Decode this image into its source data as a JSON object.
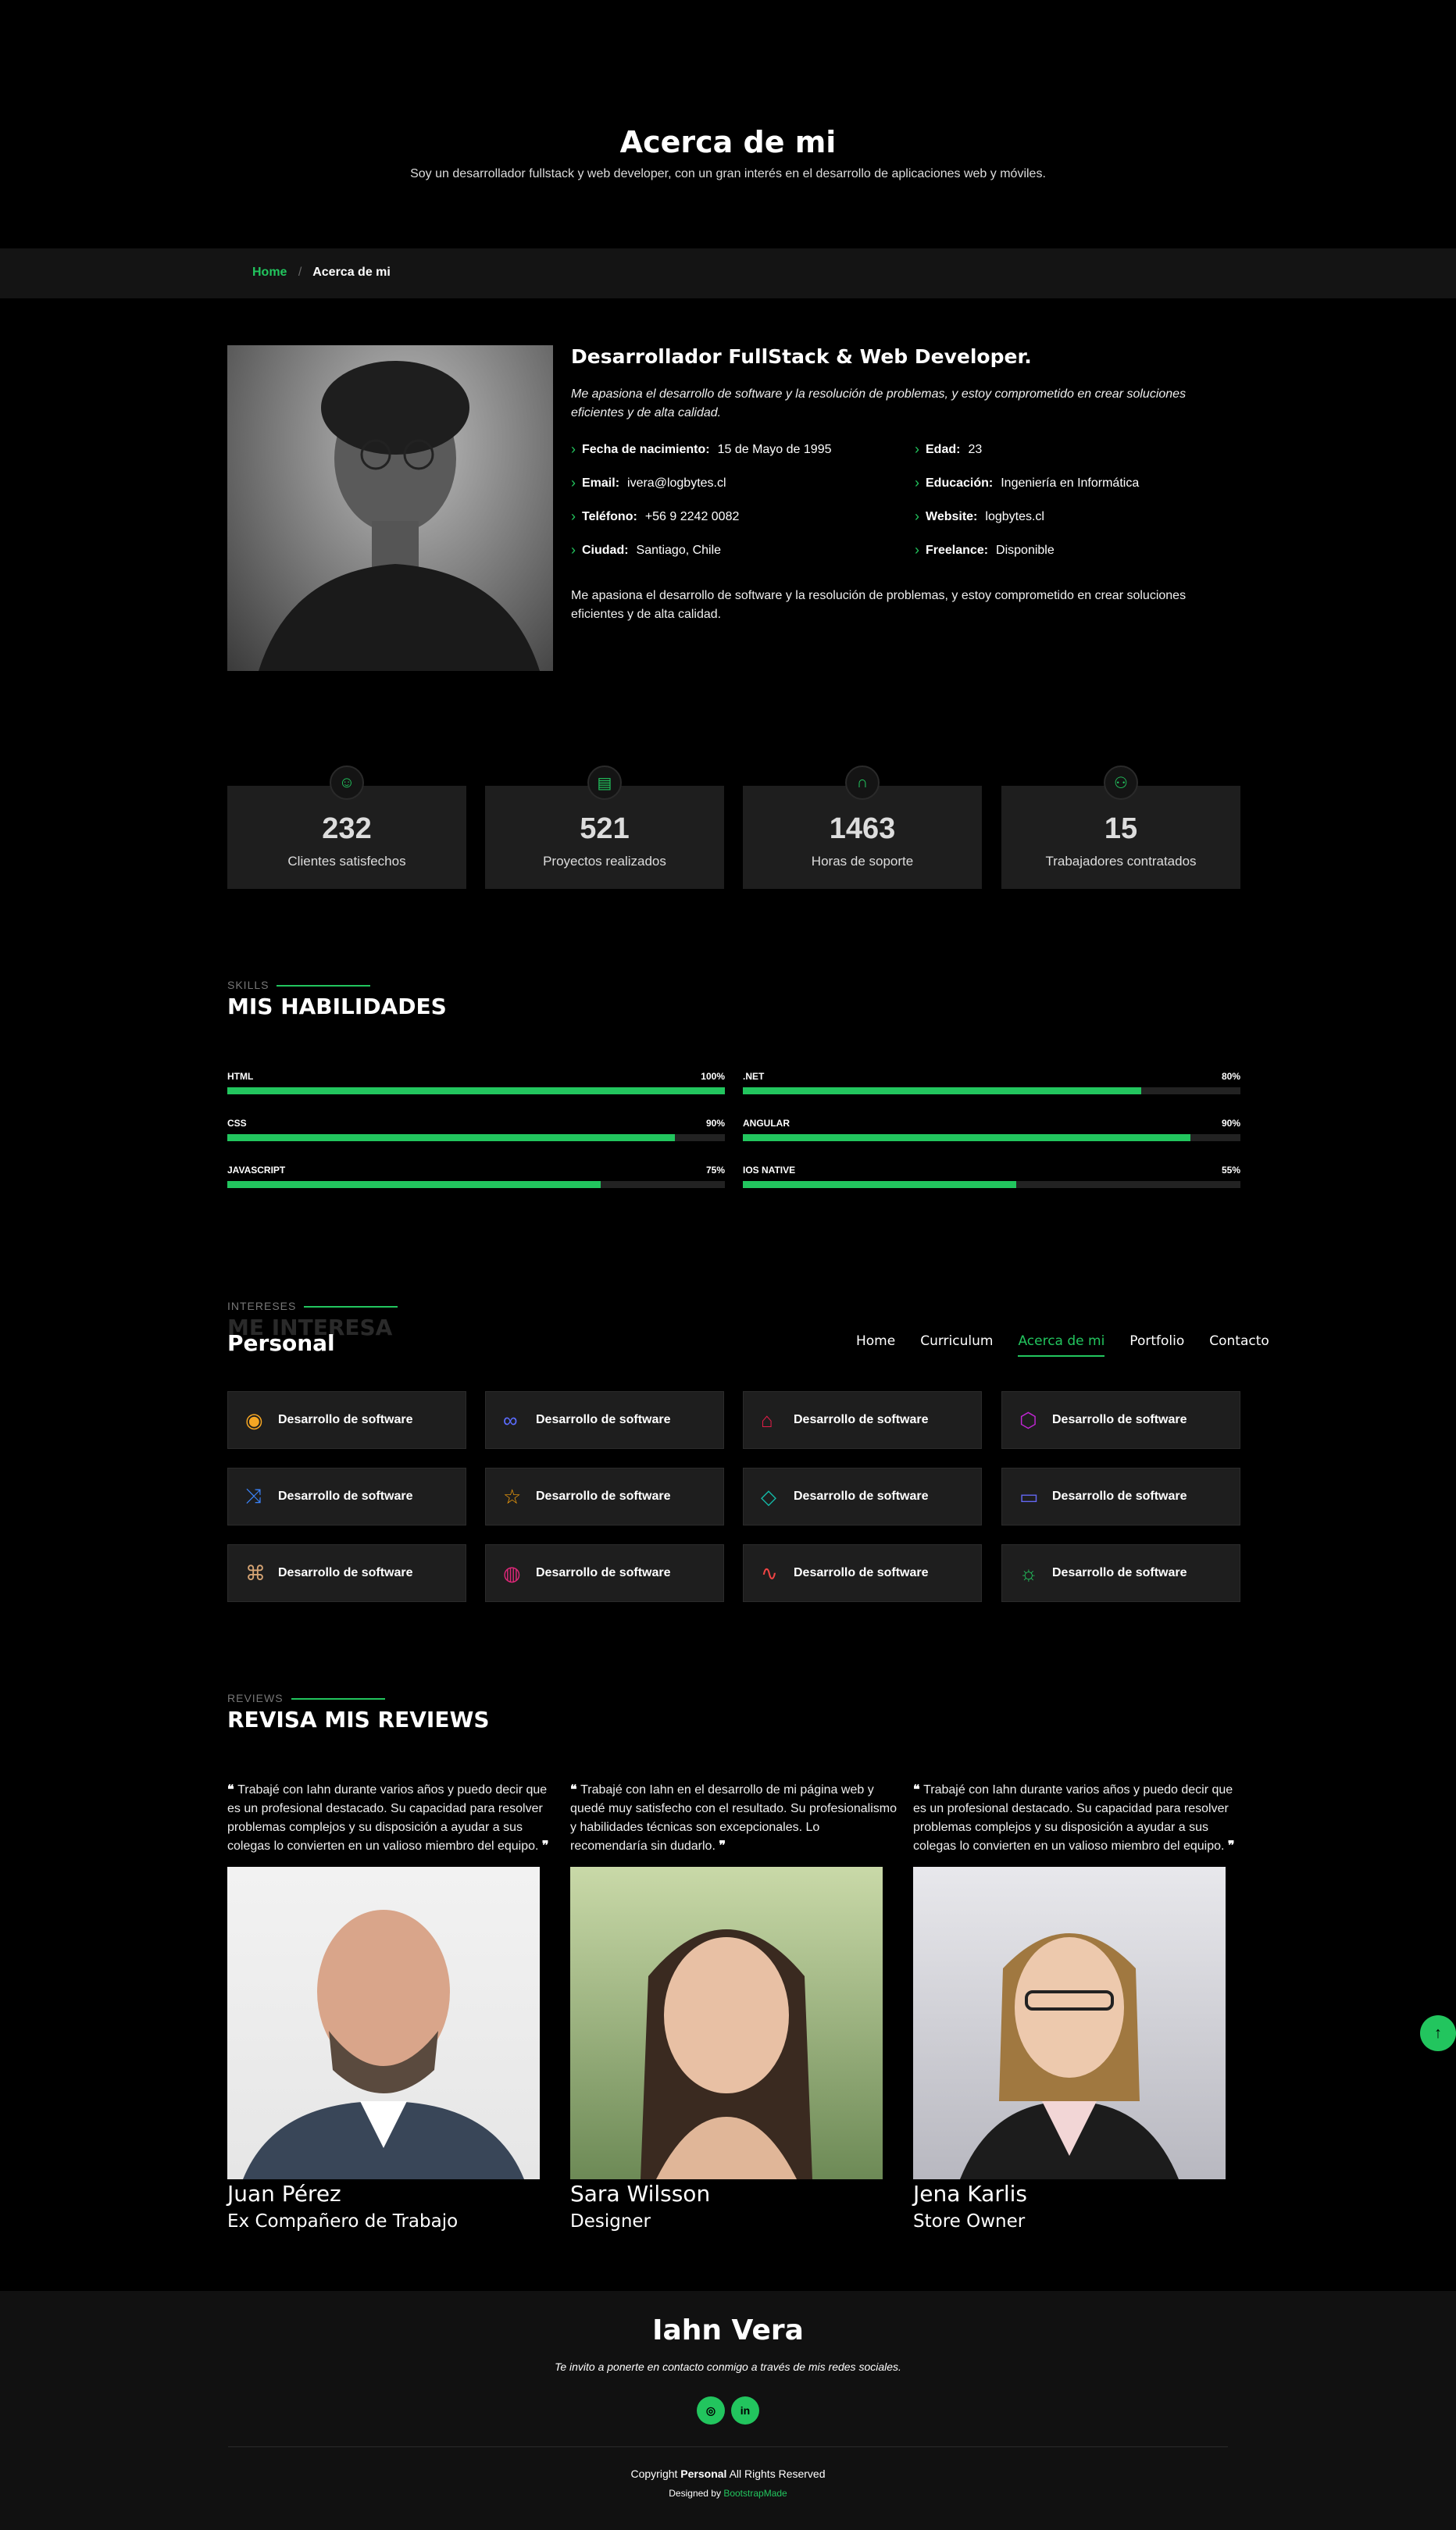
{
  "hero": {
    "title": "Acerca de mi",
    "subtitle": "Soy un desarrollador fullstack y web developer, con un gran interés en el desarrollo de aplicaciones web y móviles."
  },
  "breadcrumb": {
    "home": "Home",
    "separator": "/",
    "current": "Acerca de mi"
  },
  "about": {
    "title": "Desarrollador FullStack & Web Developer.",
    "lead": "Me apasiona el desarrollo de software y la resolución de problemas, y estoy comprometido en crear soluciones eficientes y de alta calidad.",
    "info": [
      {
        "key": "Fecha de nacimiento:",
        "value": "15 de Mayo de 1995"
      },
      {
        "key": "Edad:",
        "value": "23"
      },
      {
        "key": "Email:",
        "value": "ivera@logbytes.cl"
      },
      {
        "key": "Educación:",
        "value": "Ingeniería en Informática"
      },
      {
        "key": "Teléfono:",
        "value": "+56 9 2242 0082"
      },
      {
        "key": "Website:",
        "value": "logbytes.cl"
      },
      {
        "key": "Ciudad:",
        "value": "Santiago, Chile"
      },
      {
        "key": "Freelance:",
        "value": "Disponible"
      }
    ],
    "description": "Me apasiona el desarrollo de software y la resolución de problemas, y estoy comprometido en crear soluciones eficientes y de alta calidad."
  },
  "stats": [
    {
      "number": "232",
      "label": "Clientes satisfechos",
      "icon": "smile-icon"
    },
    {
      "number": "521",
      "label": "Proyectos realizados",
      "icon": "journal-icon"
    },
    {
      "number": "1463",
      "label": "Horas de soporte",
      "icon": "headset-icon"
    },
    {
      "number": "15",
      "label": "Trabajadores contratados",
      "icon": "people-icon"
    }
  ],
  "skills": {
    "section_label": "SKILLS",
    "title": "MIS HABILIDADES",
    "items": [
      {
        "name": "HTML",
        "percent_label": "100%",
        "value": 100
      },
      {
        "name": ".NET",
        "percent_label": "80%",
        "value": 80
      },
      {
        "name": "CSS",
        "percent_label": "90%",
        "value": 90
      },
      {
        "name": "ANGULAR",
        "percent_label": "90%",
        "value": 90
      },
      {
        "name": "JAVASCRIPT",
        "percent_label": "75%",
        "value": 75
      },
      {
        "name": "IOS NATIVE",
        "percent_label": "55%",
        "value": 55
      }
    ]
  },
  "interests": {
    "section_label": "INTERESES",
    "title_ghost": "ME INTERESA",
    "brand": "Personal",
    "items": [
      {
        "label": "Desarrollo de software",
        "icon": "eye-icon",
        "color": "#f5a623"
      },
      {
        "label": "Desarrollo de software",
        "icon": "infinity-icon",
        "color": "#5b6cff"
      },
      {
        "label": "Desarrollo de software",
        "icon": "mortarboard-icon",
        "color": "#e11d48"
      },
      {
        "label": "Desarrollo de software",
        "icon": "hexagon-icon",
        "color": "#c026d3"
      },
      {
        "label": "Desarrollo de software",
        "icon": "shuffle-icon",
        "color": "#3b82f6"
      },
      {
        "label": "Desarrollo de software",
        "icon": "star-icon",
        "color": "#f59e0b"
      },
      {
        "label": "Desarrollo de software",
        "icon": "diamond-icon",
        "color": "#14b8a6"
      },
      {
        "label": "Desarrollo de software",
        "icon": "camera-video-icon",
        "color": "#6366f1"
      },
      {
        "label": "Desarrollo de software",
        "icon": "command-icon",
        "color": "#d4a373"
      },
      {
        "label": "Desarrollo de software",
        "icon": "dribbble-icon",
        "color": "#db2777"
      },
      {
        "label": "Desarrollo de software",
        "icon": "activity-icon",
        "color": "#ef4444"
      },
      {
        "label": "Desarrollo de software",
        "icon": "sun-icon",
        "color": "#22c55e"
      }
    ]
  },
  "nav": {
    "items": [
      "Home",
      "Curriculum",
      "Acerca de mi",
      "Portfolio",
      "Contacto"
    ],
    "active": "Acerca de mi"
  },
  "reviews": {
    "section_label": "REVIEWS",
    "title": "REVISA MIS REVIEWS",
    "items": [
      {
        "quote": "Trabajé con Iahn durante varios años y puedo decir que es un profesional destacado. Su capacidad para resolver problemas complejos y su disposición a ayudar a sus colegas lo convierten en un valioso miembro del equipo.",
        "name": "Juan Pérez",
        "role": "Ex Compañero de Trabajo"
      },
      {
        "quote": "Trabajé con Iahn en el desarrollo de mi página web y quedé muy satisfecho con el resultado. Su profesionalismo y habilidades técnicas son excepcionales. Lo recomendaría sin dudarlo.",
        "name": "Sara Wilsson",
        "role": "Designer"
      },
      {
        "quote": "Trabajé con Iahn durante varios años y puedo decir que es un profesional destacado. Su capacidad para resolver problemas complejos y su disposición a ayudar a sus colegas lo convierten en un valioso miembro del equipo.",
        "name": "Jena Karlis",
        "role": "Store Owner"
      }
    ]
  },
  "footer": {
    "name": "Iahn Vera",
    "tagline": "Te invito a ponerte en contacto conmigo a través de mis redes sociales.",
    "socials": [
      "instagram-icon",
      "linkedin-icon"
    ],
    "copyright_prefix": "Copyright",
    "copyright_brand": "Personal",
    "copyright_suffix": "All Rights Reserved",
    "designed_by": "Designed by",
    "designer": "BootstrapMade"
  },
  "colors": {
    "accent": "#22c55e",
    "background": "#000000",
    "card": "#1e1e1e"
  }
}
